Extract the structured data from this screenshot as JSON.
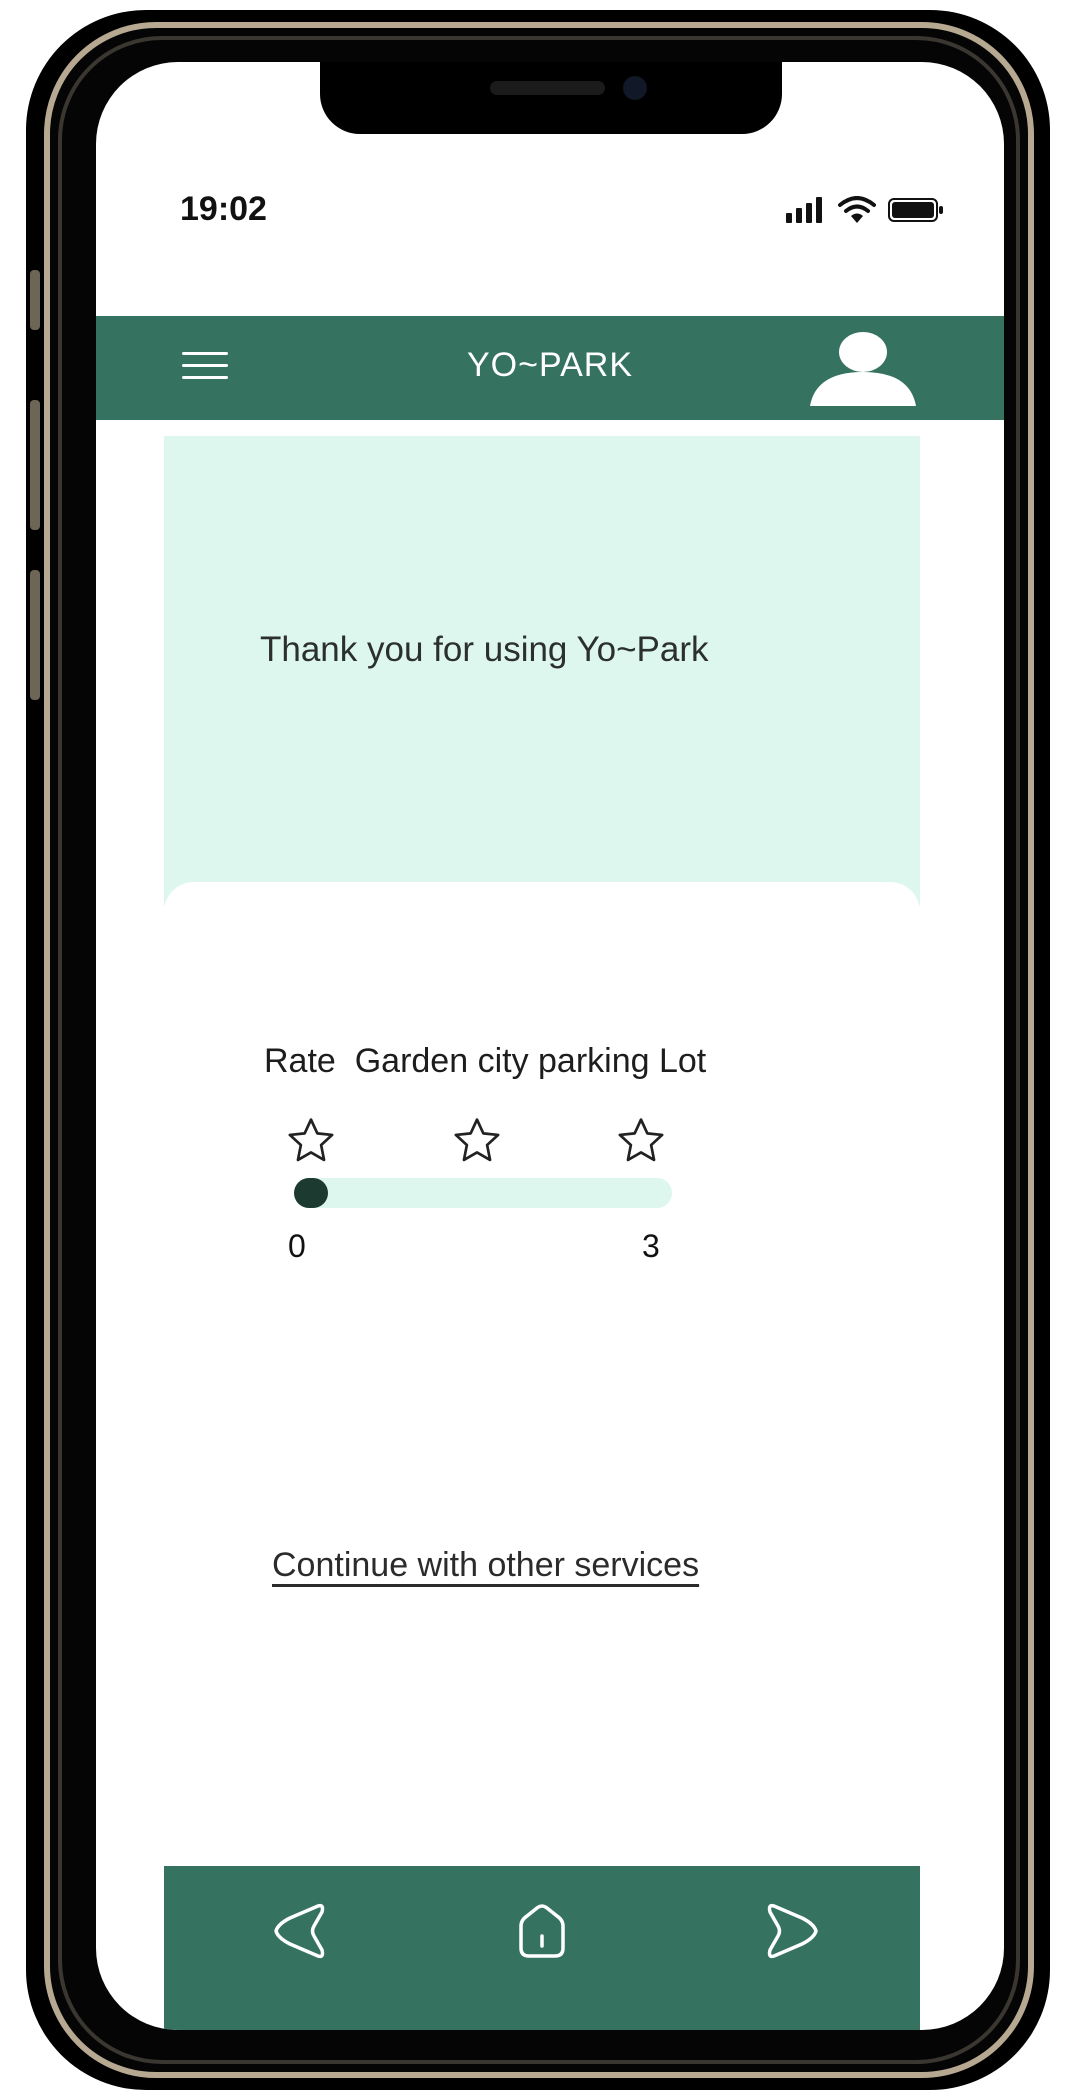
{
  "status_bar": {
    "time": "19:02",
    "icons": [
      "signal-icon",
      "wifi-icon",
      "battery-icon"
    ]
  },
  "app_bar": {
    "menu_icon": "hamburger-menu-icon",
    "title": "YO~PARK",
    "profile_icon": "user-profile-icon"
  },
  "thanks": {
    "message": "Thank you for using Yo~Park"
  },
  "rating": {
    "label": "Rate  Garden city parking Lot",
    "stars": [
      "star-outline-icon",
      "star-outline-icon",
      "star-outline-icon"
    ],
    "slider_min": "0",
    "slider_max": "3",
    "slider_value": 0
  },
  "continue_link": "Continue with other services",
  "bottom_nav": {
    "items": [
      "back-icon",
      "home-icon",
      "forward-icon"
    ]
  },
  "colors": {
    "primary": "#357360",
    "light_mint": "#ddf7ef",
    "slider_thumb": "#1d3a31"
  }
}
